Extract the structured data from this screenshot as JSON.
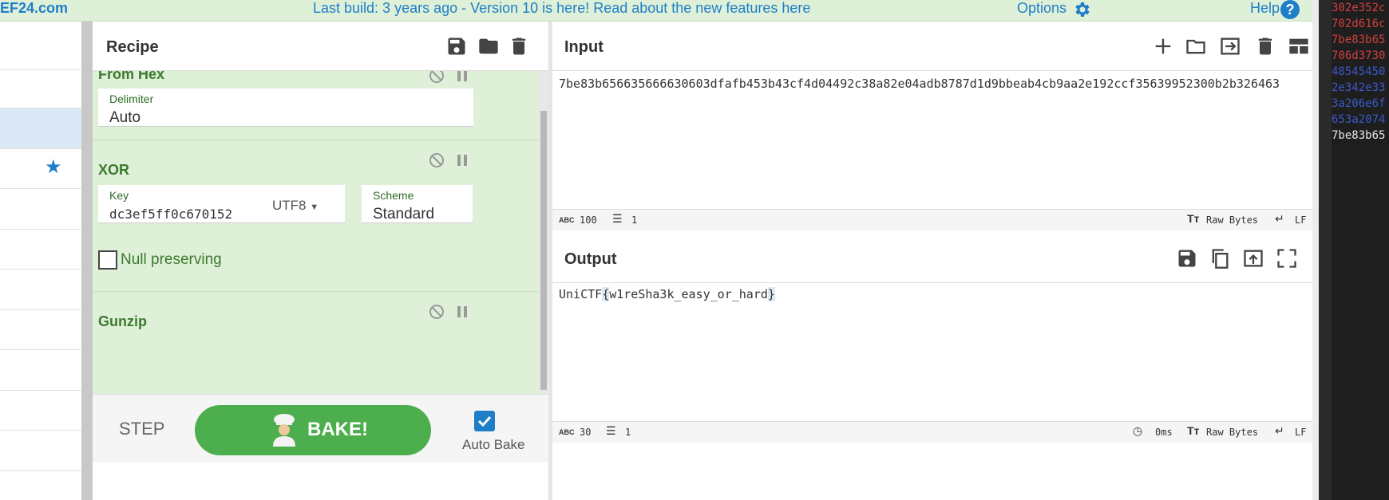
{
  "banner": {
    "brand": "EF24.com",
    "notice": "Last build: 3 years ago - Version 10 is here! Read about the new features here",
    "options": "Options",
    "help": "Help",
    "help_q": "?"
  },
  "recipe": {
    "title": "Recipe",
    "operations": [
      {
        "name": "From Hex",
        "fields": [
          {
            "label": "Delimiter",
            "value": "Auto"
          }
        ]
      },
      {
        "name": "XOR",
        "key_label": "Key",
        "key_value": "dc3ef5ff0c670152",
        "key_encoding": "UTF8",
        "scheme_label": "Scheme",
        "scheme_value": "Standard",
        "null_preserving": "Null preserving"
      },
      {
        "name": "Gunzip"
      }
    ],
    "step_label": "STEP",
    "bake_label": "BAKE!",
    "autobake_label": "Auto Bake"
  },
  "input": {
    "title": "Input",
    "text": "7be83b656635666630603dfafb453b43cf4d04492c38a82e04adb8787d1d9bbeab4cb9aa2e192ccf35639952300b2b326463",
    "status": {
      "length": "100",
      "lines": "1",
      "encoding": "Raw Bytes",
      "eol": "LF"
    }
  },
  "output": {
    "title": "Output",
    "text_a": "UniCTF",
    "text_b": "{",
    "text_c": "w1reSha3k_easy_or_hard",
    "text_d": "}",
    "status": {
      "length": "30",
      "lines": "1",
      "time": "0ms",
      "encoding": "Raw Bytes",
      "eol": "LF"
    }
  },
  "side_hex": {
    "lines": [
      {
        "text": "302e352c",
        "color": "#d04040"
      },
      {
        "text": "702d616c",
        "color": "#d04040"
      },
      {
        "text": "7be83b65",
        "color": "#d04040"
      },
      {
        "text": "706d3730",
        "color": "#d04040"
      },
      {
        "text": "48545450",
        "color": "#3c5ac8"
      },
      {
        "text": "2e342e33",
        "color": "#3c5ac8"
      },
      {
        "text": "3a206e6f",
        "color": "#3c5ac8"
      },
      {
        "text": "653a2074",
        "color": "#3c5ac8"
      },
      {
        "text": "7be83b65",
        "color": "#e8e8e8"
      }
    ]
  },
  "colors": {
    "accent": "#1e7ec8",
    "op_bg": "#dff0d8",
    "op_title": "#3b7a2d",
    "bake": "#4cae4c"
  }
}
